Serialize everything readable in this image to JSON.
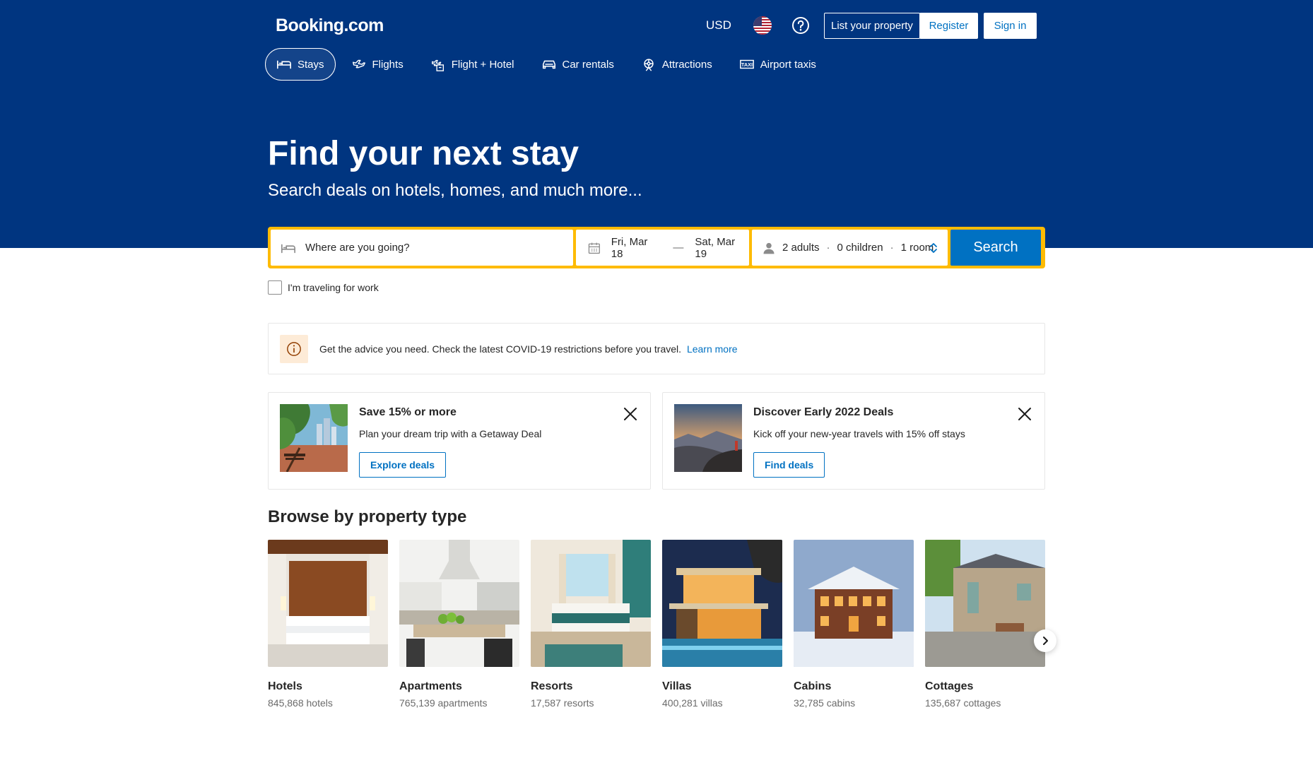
{
  "header": {
    "logo": "Booking.com",
    "currency": "USD",
    "flag_icon": "us-flag-icon",
    "help_icon": "question-circle-icon",
    "list_property": "List your property",
    "register": "Register",
    "sign_in": "Sign in"
  },
  "nav": {
    "tabs": [
      {
        "label": "Stays",
        "icon": "bed-icon",
        "active": true
      },
      {
        "label": "Flights",
        "icon": "plane-icon",
        "active": false
      },
      {
        "label": "Flight + Hotel",
        "icon": "plane-hotel-icon",
        "active": false
      },
      {
        "label": "Car rentals",
        "icon": "car-icon",
        "active": false
      },
      {
        "label": "Attractions",
        "icon": "attractions-icon",
        "active": false
      },
      {
        "label": "Airport taxis",
        "icon": "taxi-icon",
        "active": false
      }
    ]
  },
  "hero": {
    "title": "Find your next stay",
    "subtitle": "Search deals on hotels, homes, and much more..."
  },
  "search": {
    "destination_placeholder": "Where are you going?",
    "checkin": "Fri, Mar 18",
    "date_separator": "—",
    "checkout": "Sat, Mar 19",
    "adults": "2 adults",
    "children": "0 children",
    "rooms": "1 room",
    "separator": "·",
    "button": "Search"
  },
  "work_travel": {
    "label": "I'm traveling for work",
    "checked": false
  },
  "alert": {
    "text": "Get the advice you need. Check the latest COVID-19 restrictions before you travel.",
    "link": "Learn more"
  },
  "promos": [
    {
      "title": "Save 15% or more",
      "description": "Plan your dream trip with a Getaway Deal",
      "button": "Explore deals"
    },
    {
      "title": "Discover Early 2022 Deals",
      "description": "Kick off your new-year travels with 15% off stays",
      "button": "Find deals"
    }
  ],
  "property_section": {
    "title": "Browse by property type",
    "types": [
      {
        "name": "Hotels",
        "count": "845,868 hotels"
      },
      {
        "name": "Apartments",
        "count": "765,139 apartments"
      },
      {
        "name": "Resorts",
        "count": "17,587 resorts"
      },
      {
        "name": "Villas",
        "count": "400,281 villas"
      },
      {
        "name": "Cabins",
        "count": "32,785 cabins"
      },
      {
        "name": "Cottages",
        "count": "135,687 cottages"
      }
    ]
  },
  "colors": {
    "brand_blue": "#003580",
    "link_blue": "#0071c2",
    "search_yellow": "#febb02",
    "alert_bg": "#fdebd7"
  }
}
